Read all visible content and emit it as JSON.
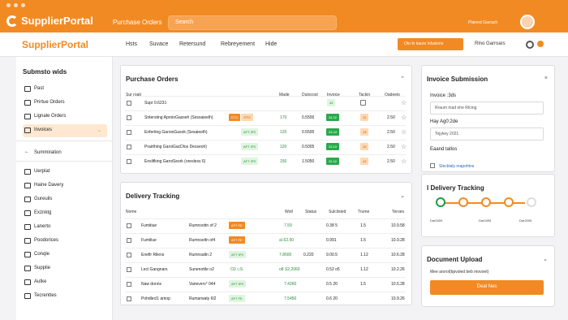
{
  "top": {
    "title": "SupplierPortal",
    "subtitle": "Purchase Orders",
    "search": "Search",
    "user": "Plained Garrach"
  },
  "nav": {
    "logo": "SupplierPortal",
    "items": [
      "Hsts",
      "Suvace",
      "Retersund",
      "Rebreyement",
      "Hide"
    ],
    "new": "Oto ln kaure lnfusions",
    "tools": "Rlno Garroars"
  },
  "sidebar": {
    "heading": "Submsto wids",
    "items": [
      "Past",
      "Prirtue Orders",
      "Lignale Orders",
      "Invoices"
    ],
    "section": "Summiration",
    "lower": [
      "Uerplat",
      "Haine Davery",
      "Gureuils",
      "Exznktg",
      "Lanerto",
      "Poodorices",
      "Conqle",
      "Supplie",
      "Autke",
      "Tecrenttes"
    ]
  },
  "purchase": {
    "title": "Purchase Orders",
    "headers": [
      "Sur roati",
      "Made",
      "Dutocost",
      "Invoice",
      "Tackin",
      "Oadeets"
    ],
    "rows": [
      [
        "Supr 0.6231",
        "",
        "",
        "",
        "44",
        ""
      ],
      [
        "Sntersting AproioGasseh (Sessaieelh)",
        "170",
        "0.5500",
        "34.32",
        "12",
        "2.50"
      ],
      [
        "Enferting GaroioGasok (Sesaieelh)",
        "120",
        "0.5500",
        "33.43",
        "13",
        "2.50"
      ],
      [
        "Prairthing GaroiGacDlos Desseoh)",
        "120",
        "0.5005",
        "33.10",
        "10",
        "2.50"
      ],
      [
        "Enslifking GaroiSesrk (oresless 6)",
        "150",
        "1.5050",
        "32.42",
        "12",
        "2.50"
      ]
    ]
  },
  "delivery": {
    "title": "Delivery Tracking",
    "headers": [
      "Nome",
      "Wotl",
      "Status",
      "Sulclisted",
      "Trume",
      "Teroes"
    ],
    "rows": [
      [
        "Fumitiue",
        "Rumnsottn of 2",
        "7.59",
        "0.38 5",
        "1.5",
        "10.9.58"
      ],
      [
        "Fumiliue",
        "Rumnseltn of4",
        "a/.62.50",
        "0.991",
        "1.5",
        "10.9.28"
      ],
      [
        "Enefir Rilens",
        "Rumnsaltn 2",
        "7.8600",
        "0.220",
        "9.00.5",
        "1.12",
        "10.6.28"
      ],
      [
        "Lecl Gangnars",
        "Sunenottle o2",
        "o8 S2,2060",
        "0.52 o5",
        "1.12",
        "10.2.26"
      ],
      [
        "Naw donns",
        "Varieverv° 044",
        "7.4260",
        "0.5 20",
        "1.5",
        "10.5.28"
      ],
      [
        "Pohdlecl1 amop",
        "Rumarwaty 6l2",
        "7.5450",
        "0.6 20",
        "",
        "10.9.26"
      ]
    ]
  },
  "invoice": {
    "title": "Invoice Submission",
    "label1": "Invoice :3ds",
    "field1": "Rraum mad ehe Rtcing",
    "label2": "Hay Ag0:2de",
    "field2": "Tojykey 2021",
    "label3": "Eaand tatlos",
    "check": "Slecbialy mapohtns"
  },
  "track": {
    "title": "l Delivery Tracking",
    "labels": [
      "Dar0405",
      "Dar0495",
      "Dar2006"
    ]
  },
  "doc": {
    "title": "Document Upload",
    "text": "Mee arorol(bpvoled beb movoet)",
    "button": "Deal Nes"
  }
}
